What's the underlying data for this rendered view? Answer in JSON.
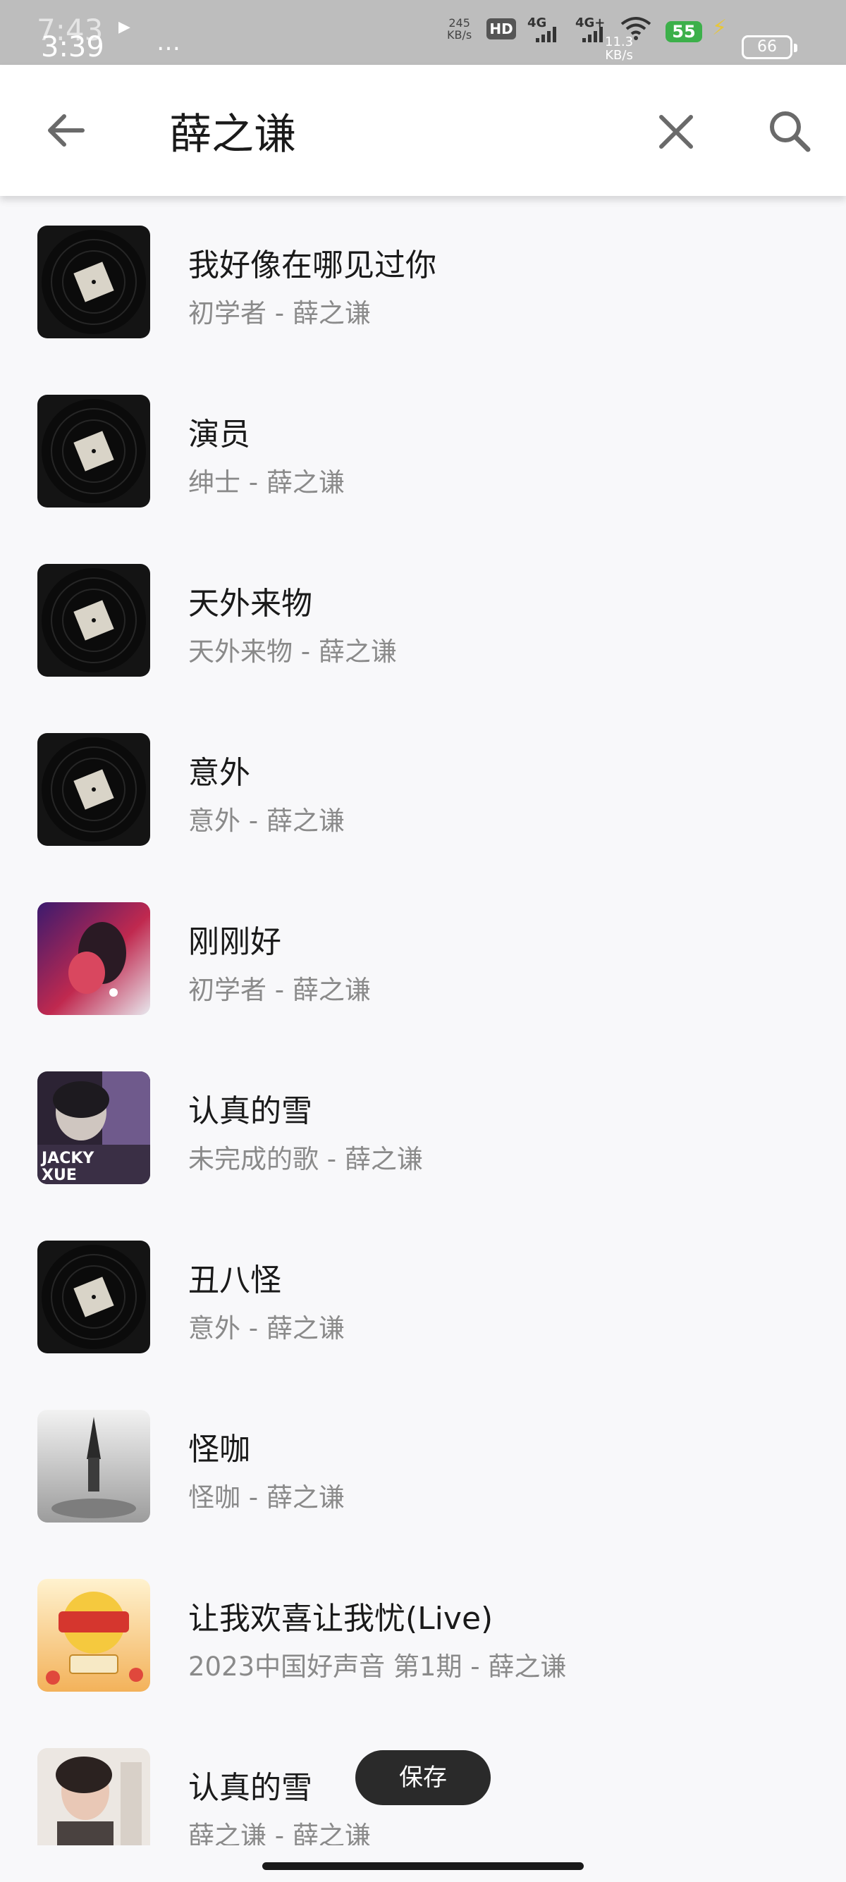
{
  "status_bar": {
    "time_under": "7:43",
    "time": "3:39",
    "data_rate_1": "245\nKB/s",
    "hd_badge": "HD",
    "network_1": "4G",
    "network_2": "4G+",
    "data_rate_2": "11.3\nKB/s",
    "signal_badge": "55",
    "battery": "66"
  },
  "search": {
    "query": "薛之谦",
    "back_icon": "arrow-left-icon",
    "clear_icon": "close-icon",
    "search_icon": "search-icon"
  },
  "results": [
    {
      "title": "我好像在哪见过你",
      "subtitle": "初学者 - 薛之谦",
      "cover": "vinyl-record"
    },
    {
      "title": "演员",
      "subtitle": "绅士 - 薛之谦",
      "cover": "vinyl-record"
    },
    {
      "title": "天外来物",
      "subtitle": "天外来物 - 薛之谦",
      "cover": "vinyl-record"
    },
    {
      "title": "意外",
      "subtitle": "意外 - 薛之谦",
      "cover": "vinyl-record"
    },
    {
      "title": "刚刚好",
      "subtitle": "初学者 - 薛之谦",
      "cover": "portrait-neon"
    },
    {
      "title": "认真的雪",
      "subtitle": "未完成的歌 - 薛之谦",
      "cover": "album-jacky-xue"
    },
    {
      "title": "丑八怪",
      "subtitle": "意外 - 薛之谦",
      "cover": "vinyl-record"
    },
    {
      "title": "怪咖",
      "subtitle": "怪咖 - 薛之谦",
      "cover": "album-grey"
    },
    {
      "title": "让我欢喜让我忧(Live)",
      "subtitle": "2023中国好声音 第1期 - 薛之谦",
      "cover": "show-poster"
    },
    {
      "title": "认真的雪",
      "subtitle": "薛之谦 - 薛之谦",
      "cover": "portrait-light"
    }
  ],
  "toast": {
    "label": "保存"
  },
  "colors": {
    "accent_green": "#3cb04a",
    "header_bg": "#ffffff",
    "list_bg": "#f8f8fa",
    "subtitle_gray": "#8a8a8a"
  }
}
